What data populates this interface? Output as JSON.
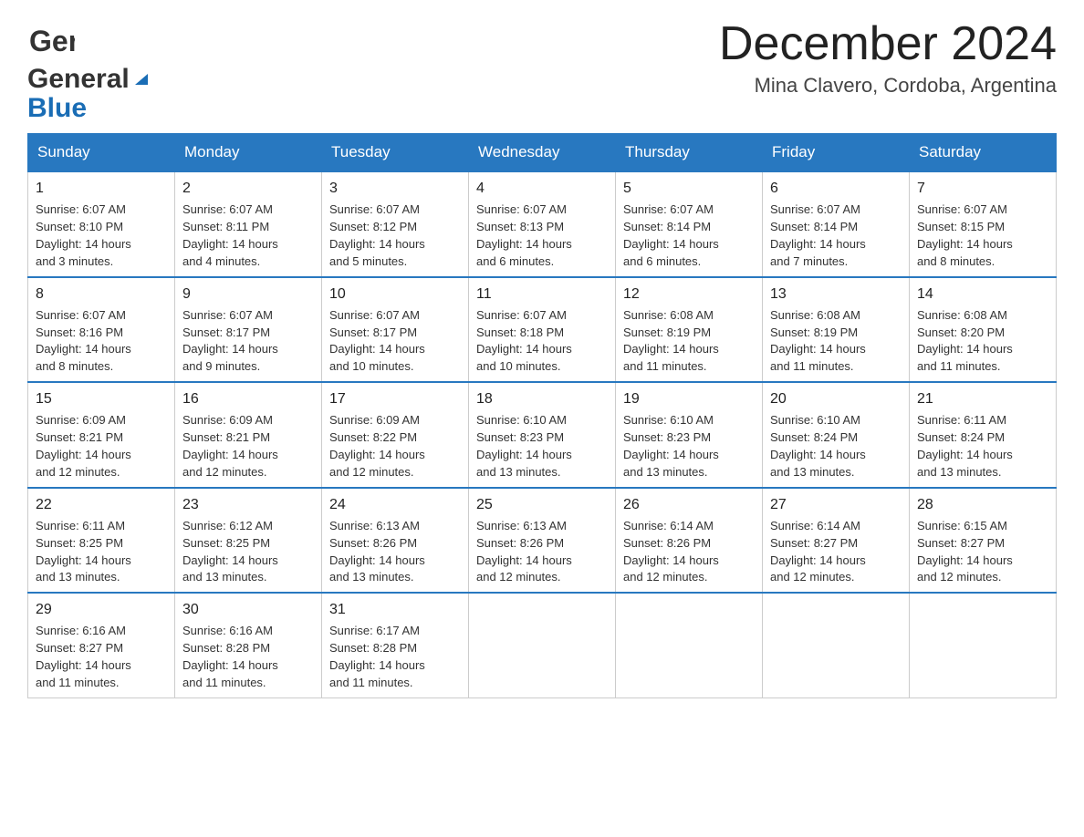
{
  "logo": {
    "general": "General",
    "blue": "Blue"
  },
  "title": "December 2024",
  "subtitle": "Mina Clavero, Cordoba, Argentina",
  "days_of_week": [
    "Sunday",
    "Monday",
    "Tuesday",
    "Wednesday",
    "Thursday",
    "Friday",
    "Saturday"
  ],
  "weeks": [
    [
      {
        "day": "1",
        "sunrise": "6:07 AM",
        "sunset": "8:10 PM",
        "daylight": "14 hours and 3 minutes."
      },
      {
        "day": "2",
        "sunrise": "6:07 AM",
        "sunset": "8:11 PM",
        "daylight": "14 hours and 4 minutes."
      },
      {
        "day": "3",
        "sunrise": "6:07 AM",
        "sunset": "8:12 PM",
        "daylight": "14 hours and 5 minutes."
      },
      {
        "day": "4",
        "sunrise": "6:07 AM",
        "sunset": "8:13 PM",
        "daylight": "14 hours and 6 minutes."
      },
      {
        "day": "5",
        "sunrise": "6:07 AM",
        "sunset": "8:14 PM",
        "daylight": "14 hours and 6 minutes."
      },
      {
        "day": "6",
        "sunrise": "6:07 AM",
        "sunset": "8:14 PM",
        "daylight": "14 hours and 7 minutes."
      },
      {
        "day": "7",
        "sunrise": "6:07 AM",
        "sunset": "8:15 PM",
        "daylight": "14 hours and 8 minutes."
      }
    ],
    [
      {
        "day": "8",
        "sunrise": "6:07 AM",
        "sunset": "8:16 PM",
        "daylight": "14 hours and 8 minutes."
      },
      {
        "day": "9",
        "sunrise": "6:07 AM",
        "sunset": "8:17 PM",
        "daylight": "14 hours and 9 minutes."
      },
      {
        "day": "10",
        "sunrise": "6:07 AM",
        "sunset": "8:17 PM",
        "daylight": "14 hours and 10 minutes."
      },
      {
        "day": "11",
        "sunrise": "6:07 AM",
        "sunset": "8:18 PM",
        "daylight": "14 hours and 10 minutes."
      },
      {
        "day": "12",
        "sunrise": "6:08 AM",
        "sunset": "8:19 PM",
        "daylight": "14 hours and 11 minutes."
      },
      {
        "day": "13",
        "sunrise": "6:08 AM",
        "sunset": "8:19 PM",
        "daylight": "14 hours and 11 minutes."
      },
      {
        "day": "14",
        "sunrise": "6:08 AM",
        "sunset": "8:20 PM",
        "daylight": "14 hours and 11 minutes."
      }
    ],
    [
      {
        "day": "15",
        "sunrise": "6:09 AM",
        "sunset": "8:21 PM",
        "daylight": "14 hours and 12 minutes."
      },
      {
        "day": "16",
        "sunrise": "6:09 AM",
        "sunset": "8:21 PM",
        "daylight": "14 hours and 12 minutes."
      },
      {
        "day": "17",
        "sunrise": "6:09 AM",
        "sunset": "8:22 PM",
        "daylight": "14 hours and 12 minutes."
      },
      {
        "day": "18",
        "sunrise": "6:10 AM",
        "sunset": "8:23 PM",
        "daylight": "14 hours and 13 minutes."
      },
      {
        "day": "19",
        "sunrise": "6:10 AM",
        "sunset": "8:23 PM",
        "daylight": "14 hours and 13 minutes."
      },
      {
        "day": "20",
        "sunrise": "6:10 AM",
        "sunset": "8:24 PM",
        "daylight": "14 hours and 13 minutes."
      },
      {
        "day": "21",
        "sunrise": "6:11 AM",
        "sunset": "8:24 PM",
        "daylight": "14 hours and 13 minutes."
      }
    ],
    [
      {
        "day": "22",
        "sunrise": "6:11 AM",
        "sunset": "8:25 PM",
        "daylight": "14 hours and 13 minutes."
      },
      {
        "day": "23",
        "sunrise": "6:12 AM",
        "sunset": "8:25 PM",
        "daylight": "14 hours and 13 minutes."
      },
      {
        "day": "24",
        "sunrise": "6:13 AM",
        "sunset": "8:26 PM",
        "daylight": "14 hours and 13 minutes."
      },
      {
        "day": "25",
        "sunrise": "6:13 AM",
        "sunset": "8:26 PM",
        "daylight": "14 hours and 12 minutes."
      },
      {
        "day": "26",
        "sunrise": "6:14 AM",
        "sunset": "8:26 PM",
        "daylight": "14 hours and 12 minutes."
      },
      {
        "day": "27",
        "sunrise": "6:14 AM",
        "sunset": "8:27 PM",
        "daylight": "14 hours and 12 minutes."
      },
      {
        "day": "28",
        "sunrise": "6:15 AM",
        "sunset": "8:27 PM",
        "daylight": "14 hours and 12 minutes."
      }
    ],
    [
      {
        "day": "29",
        "sunrise": "6:16 AM",
        "sunset": "8:27 PM",
        "daylight": "14 hours and 11 minutes."
      },
      {
        "day": "30",
        "sunrise": "6:16 AM",
        "sunset": "8:28 PM",
        "daylight": "14 hours and 11 minutes."
      },
      {
        "day": "31",
        "sunrise": "6:17 AM",
        "sunset": "8:28 PM",
        "daylight": "14 hours and 11 minutes."
      },
      null,
      null,
      null,
      null
    ]
  ],
  "labels": {
    "sunrise": "Sunrise:",
    "sunset": "Sunset:",
    "daylight": "Daylight:"
  }
}
